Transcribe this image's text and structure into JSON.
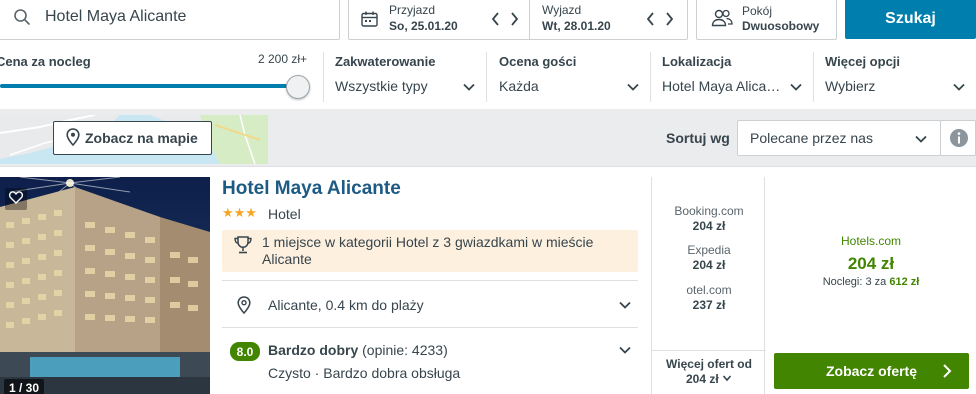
{
  "search": {
    "query": "Hotel Maya Alicante",
    "checkin_label": "Przyjazd",
    "checkin_value": "So, 25.01.20",
    "checkout_label": "Wyjazd",
    "checkout_value": "Wt, 28.01.20",
    "room_label": "Pokój",
    "room_value": "Dwuosobowy",
    "search_button": "Szukaj"
  },
  "filters": {
    "price": {
      "title": "Cena za nocleg",
      "max_label": "2 200 zł+",
      "level": 1.0
    },
    "accommodation": {
      "title": "Zakwaterowanie",
      "value": "Wszystkie typy"
    },
    "rating": {
      "title": "Ocena gości",
      "value": "Każda"
    },
    "location": {
      "title": "Lokalizacja",
      "value": "Hotel Maya Alica…"
    },
    "more": {
      "title": "Więcej opcji",
      "value": "Wybierz"
    }
  },
  "sortbar": {
    "map_button": "Zobacz na mapie",
    "sort_label": "Sortuj wg",
    "sort_value": "Polecane przez nas"
  },
  "hotel": {
    "name": "Hotel Maya Alicante",
    "stars": "★★★",
    "type": "Hotel",
    "award": "1 miejsce w kategorii Hotel z 3 gwiazdkami w mieście Alicante",
    "location": "Alicante, 0.4 km do plaży",
    "rating_score": "8.0",
    "rating_word": "Bardzo dobry",
    "rating_reviews": "(opinie: 4233)",
    "rating_detail": "Czysto · Bardzo dobra obsługa",
    "image_count": "1 / 30",
    "offers": [
      {
        "site": "Booking.com",
        "price": "204 zł"
      },
      {
        "site": "Expedia",
        "price": "204 zł"
      },
      {
        "site": "otel.com",
        "price": "237 zł"
      }
    ],
    "more_offers_label": "Więcej ofert od",
    "more_offers_price": "204 zł",
    "best_site": "Hotels.com",
    "best_price": "204 zł",
    "best_nights_prefix": "Noclegi: 3 za",
    "best_total": "612 zł",
    "deal_button": "Zobacz ofertę"
  },
  "colors": {
    "primary_blue": "#007faf",
    "deal_green": "#428500",
    "hotel_link": "#1d5b85",
    "award_bg": "#fdf0df",
    "star": "#f5a623"
  },
  "icons": [
    "search-icon",
    "calendar-icon",
    "chevron-left-icon",
    "chevron-right-icon",
    "people-icon",
    "chevron-down-icon",
    "map-pin-icon",
    "info-icon",
    "heart-icon",
    "trophy-icon",
    "location-pin-icon",
    "chevron-right-icon"
  ]
}
